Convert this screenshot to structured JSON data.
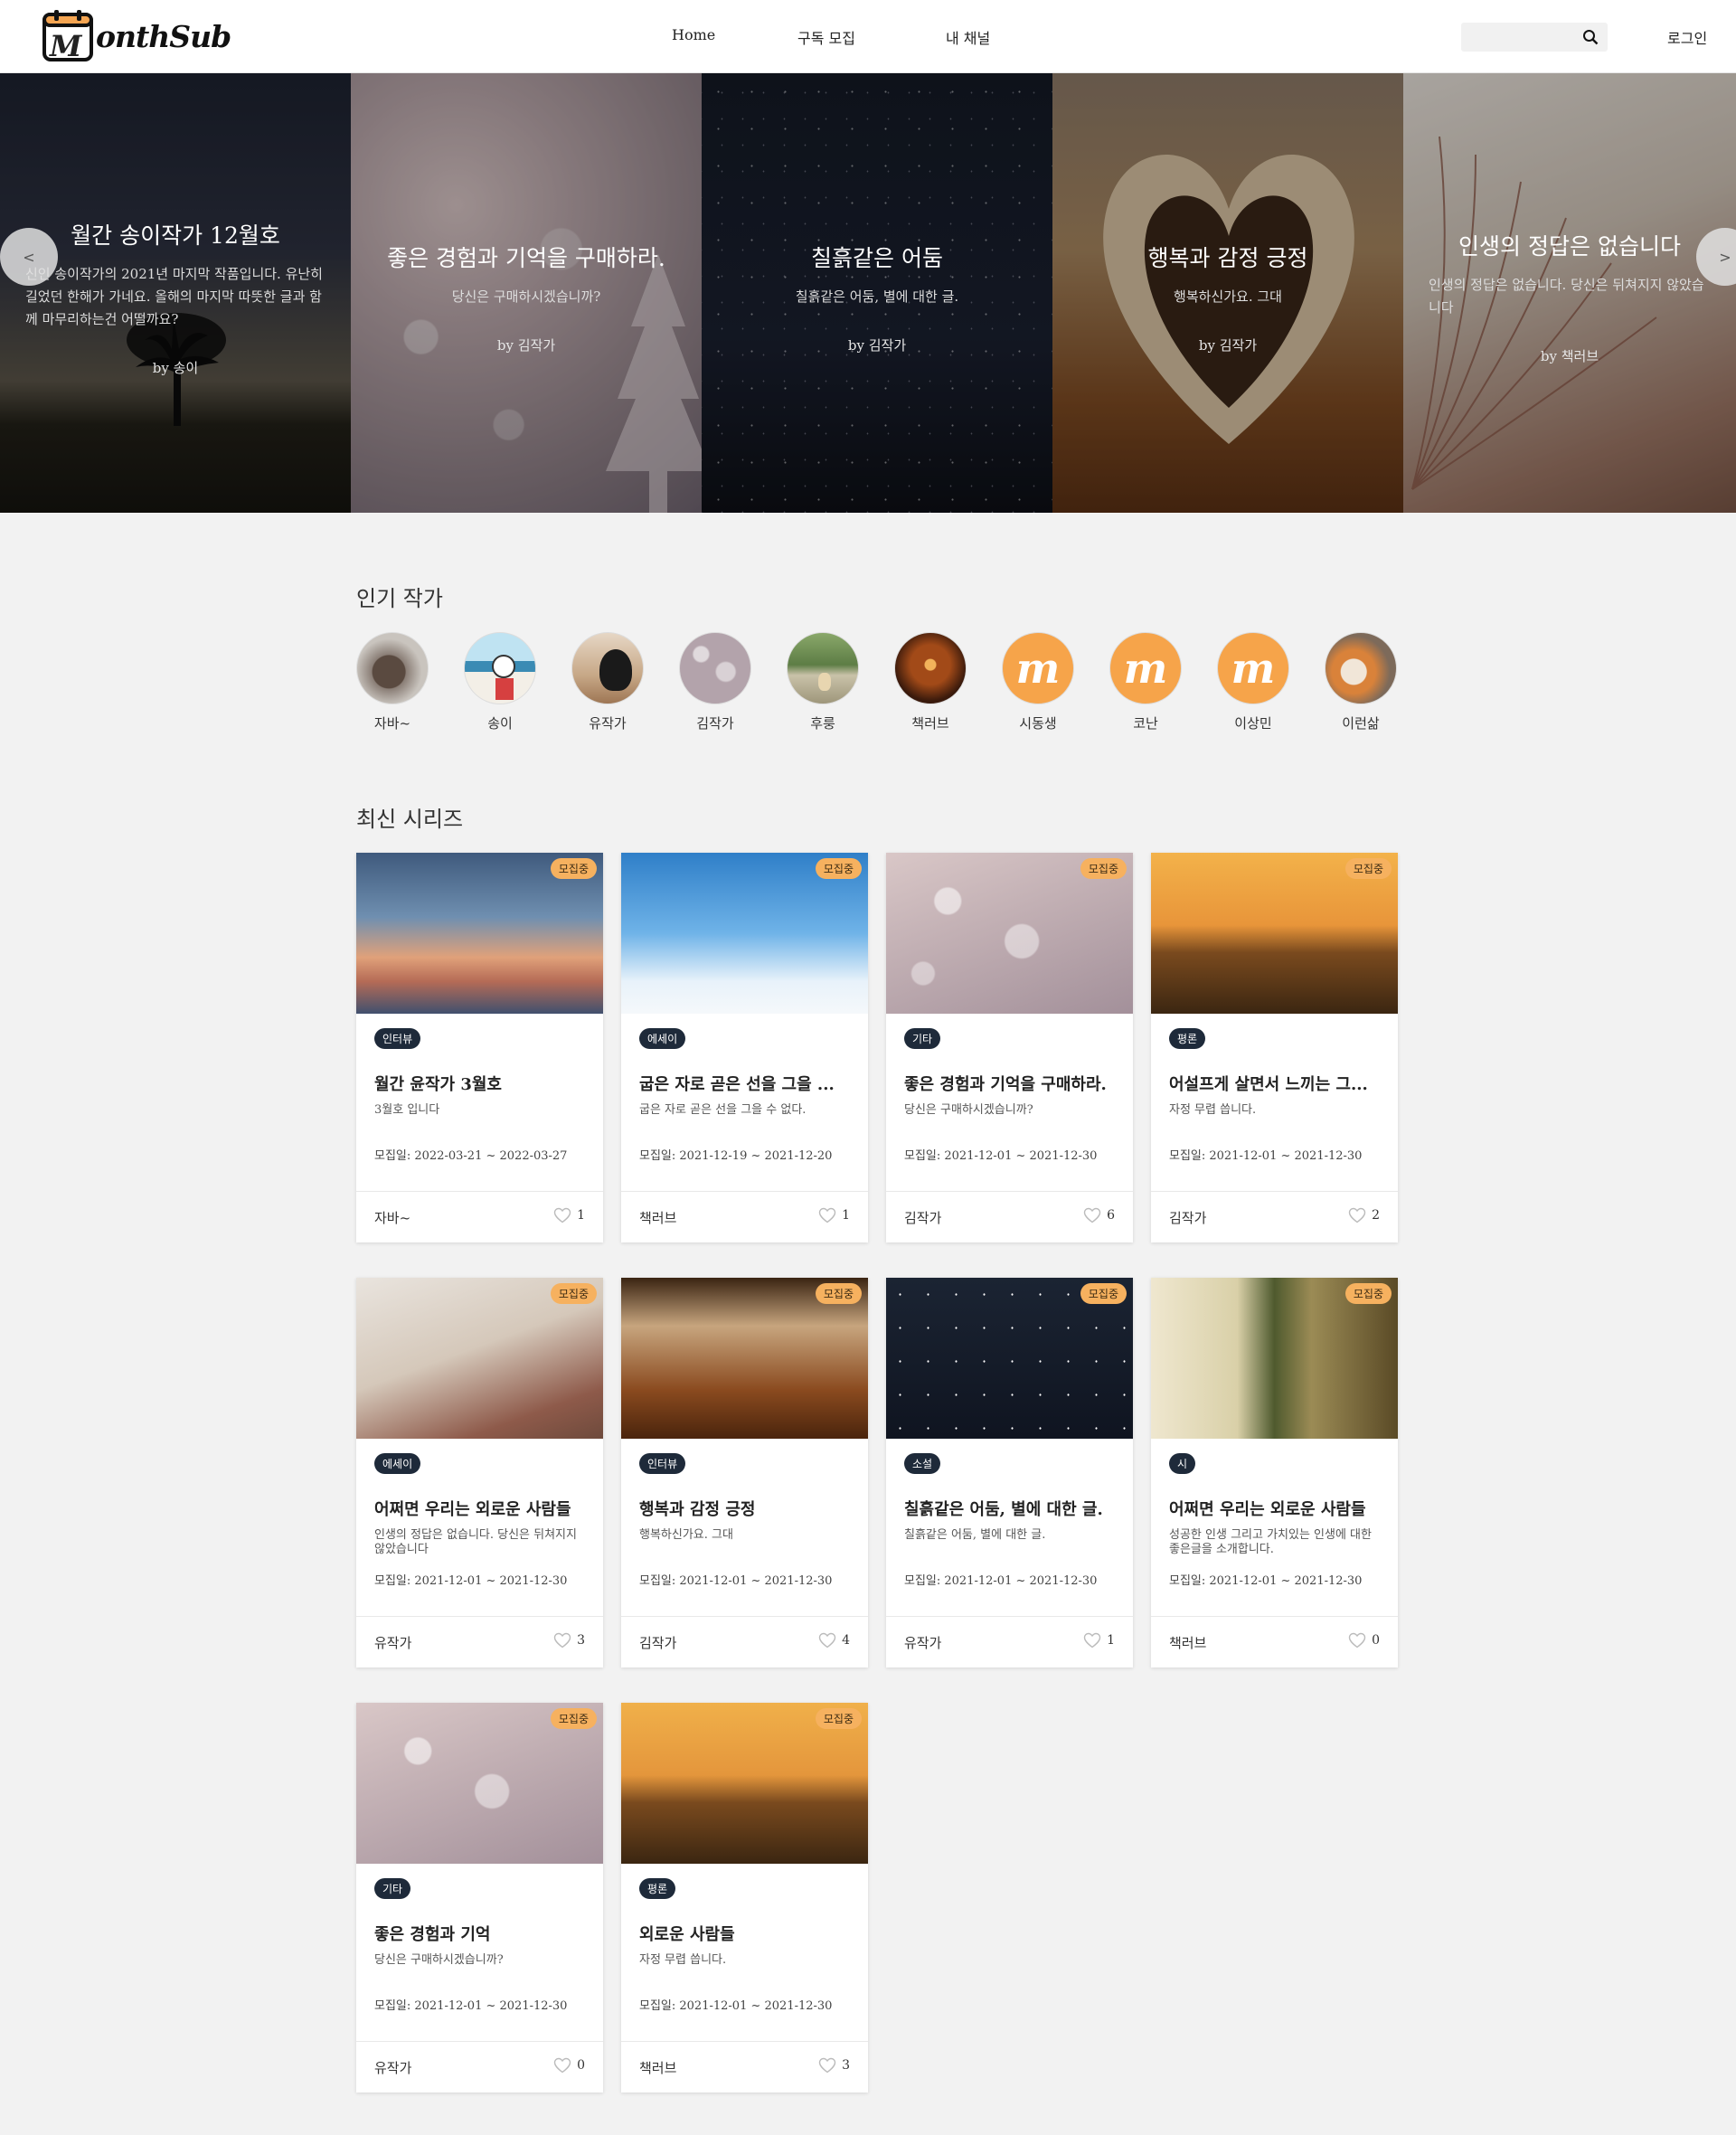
{
  "header": {
    "logo_letter": "M",
    "logo_text": "onthSub",
    "nav": [
      "Home",
      "구독 모집",
      "내 채널"
    ],
    "search_placeholder": "",
    "login_label": "로그인",
    "icons": {
      "search": "search-icon",
      "logo": "calendar-icon"
    }
  },
  "hero": {
    "prev_label": "<",
    "next_label": ">",
    "slides": [
      {
        "title": "월간 송이작가 12월호",
        "desc": "신인 송이작가의 2021년 마지막 작품입니다. 유난히 길었던 한해가 가네요. 올해의 마지막 따뜻한 글과 함께 마무리하는건 어떨까요?",
        "author": "by 송이"
      },
      {
        "title": "좋은 경험과 기억을 구매하라.",
        "desc": "당신은 구매하시겠습니까?",
        "author": "by 김작가"
      },
      {
        "title": "칠흙같은 어둠",
        "desc": "칠흙같은 어둠, 별에 대한 글.",
        "author": "by 김작가"
      },
      {
        "title": "행복과 감정 긍정",
        "desc": "행복하신가요. 그대",
        "author": "by 김작가"
      },
      {
        "title": "인생의 정답은 없습니다",
        "desc": "인생의 정답은 없습니다. 당신은 뒤쳐지지 않았습니다",
        "author": "by 책러브"
      }
    ]
  },
  "popular": {
    "title": "인기 작가",
    "authors": [
      "자바~",
      "송이",
      "유작가",
      "김작가",
      "후룽",
      "책러브",
      "시동생",
      "코난",
      "이상민",
      "이런삶"
    ]
  },
  "latest": {
    "title": "최신 시리즈",
    "cards": [
      {
        "status": "모집중",
        "tag": "인터뷰",
        "title": "월간 윤작가 3월호",
        "desc": "3월호 입니다",
        "date": "모집일: 2022-03-21 ~ 2022-03-27",
        "author": "자바~",
        "likes": "1"
      },
      {
        "status": "모집중",
        "tag": "에세이",
        "title": "굽은 자로 곧은 선을 그을 ...",
        "desc": "굽은 자로 곧은 선을 그을 수 없다.",
        "date": "모집일: 2021-12-19 ~ 2021-12-20",
        "author": "책러브",
        "likes": "1"
      },
      {
        "status": "모집중",
        "tag": "기타",
        "title": "좋은 경험과 기억을 구매하라.",
        "desc": "당신은 구매하시겠습니까?",
        "date": "모집일: 2021-12-01 ~ 2021-12-30",
        "author": "김작가",
        "likes": "6"
      },
      {
        "status": "모집중",
        "tag": "평론",
        "title": "어설프게 살면서 느끼는 그...",
        "desc": "자정 무렵 씁니다.",
        "date": "모집일: 2021-12-01 ~ 2021-12-30",
        "author": "김작가",
        "likes": "2"
      },
      {
        "status": "모집중",
        "tag": "에세이",
        "title": "어쩌면 우리는 외로운 사람들",
        "desc": "인생의 정답은 없습니다. 당신은 뒤쳐지지 않았습니다",
        "date": "모집일: 2021-12-01 ~ 2021-12-30",
        "author": "유작가",
        "likes": "3"
      },
      {
        "status": "모집중",
        "tag": "인터뷰",
        "title": "행복과 감정 긍정",
        "desc": "행복하신가요. 그대",
        "date": "모집일: 2021-12-01 ~ 2021-12-30",
        "author": "김작가",
        "likes": "4"
      },
      {
        "status": "모집중",
        "tag": "소설",
        "title": "칠흙같은 어둠, 별에 대한 글.",
        "desc": "칠흙같은 어둠, 별에 대한 글.",
        "date": "모집일: 2021-12-01 ~ 2021-12-30",
        "author": "유작가",
        "likes": "1"
      },
      {
        "status": "모집중",
        "tag": "시",
        "title": "어쩌면 우리는 외로운 사람들",
        "desc": "성공한 인생 그리고 가치있는 인생에 대한 좋은글을 소개합니다.",
        "date": "모집일: 2021-12-01 ~ 2021-12-30",
        "author": "책러브",
        "likes": "0"
      },
      {
        "status": "모집중",
        "tag": "기타",
        "title": "좋은 경험과 기억",
        "desc": "당신은 구매하시겠습니까?",
        "date": "모집일: 2021-12-01 ~ 2021-12-30",
        "author": "유작가",
        "likes": "0"
      },
      {
        "status": "모집중",
        "tag": "평론",
        "title": "외로운 사람들",
        "desc": "자정 무렵 씁니다.",
        "date": "모집일: 2021-12-01 ~ 2021-12-30",
        "author": "책러브",
        "likes": "3"
      }
    ]
  },
  "colors": {
    "accent": "#f6b15f",
    "tag_bg": "#1e2a3a",
    "page_bg": "#f2f2f2"
  }
}
